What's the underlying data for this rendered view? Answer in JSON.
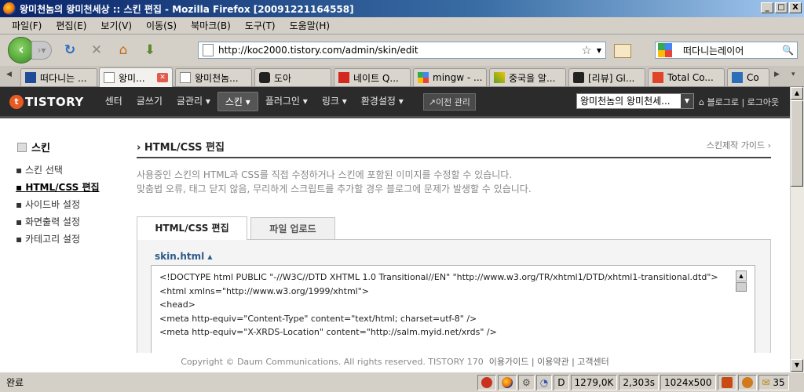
{
  "window": {
    "title": "왕미천놈의 왕미천세상 :: 스킨 편집 - Mozilla Firefox [20091221164558]",
    "controls": [
      "_",
      "□",
      "X"
    ]
  },
  "menu": [
    "파일(F)",
    "편집(E)",
    "보기(V)",
    "이동(S)",
    "북마크(B)",
    "도구(T)",
    "도움말(H)"
  ],
  "nav": {
    "url": "http://koc2000.tistory.com/admin/skin/edit",
    "search_value": "떠다니는레이어"
  },
  "tabs": [
    {
      "label": "떠다니는 ...",
      "active": false
    },
    {
      "label": "왕미...",
      "active": true
    },
    {
      "label": "왕미천놈...",
      "active": false
    },
    {
      "label": "도아",
      "active": false
    },
    {
      "label": "네이트 Q...",
      "active": false
    },
    {
      "label": "mingw - ...",
      "active": false
    },
    {
      "label": "중국을 알...",
      "active": false
    },
    {
      "label": "[리뷰] Gl...",
      "active": false
    },
    {
      "label": "Total Co...",
      "active": false
    },
    {
      "label": "Co",
      "active": false
    }
  ],
  "site": {
    "logo": "TISTORY",
    "logo_mark": "t",
    "gnb": [
      "센터",
      "글쓰기",
      "글관리 ▾",
      "스킨 ▾",
      "플러그인 ▾",
      "링크 ▾",
      "환경설정 ▾"
    ],
    "old_admin": "↗이전 관리",
    "blog_select": "왕미천놈의 왕미천세...",
    "top_links": "⌂ 블로그로  |  로그아웃"
  },
  "lnb": {
    "title": "스킨",
    "items": [
      "스킨 선택",
      "HTML/CSS 편집",
      "사이드바 설정",
      "화면출력 설정",
      "카테고리 설정"
    ]
  },
  "content": {
    "title": "HTML/CSS 편집",
    "guide": "스킨제작 가이드 ›",
    "desc1": "사용중인 스킨의 HTML과 CSS를 직접 수정하거나 스킨에 포함된 이미지를 수정할 수 있습니다.",
    "desc2": "맞춤법 오류, 태그 닫지 않음, 무리하게 스크립트를 추가할 경우 블로그에 문제가 발생할 수 있습니다.",
    "tab_edit": "HTML/CSS 편집",
    "tab_upload": "파일 업로드",
    "file": "skin.html ▴",
    "code": [
      "<!DOCTYPE html PUBLIC \"-//W3C//DTD XHTML 1.0 Transitional//EN\" \"http://www.w3.org/TR/xhtml1/DTD/xhtml1-transitional.dtd\">",
      "<html xmlns=\"http://www.w3.org/1999/xhtml\">",
      "<head>",
      "<meta http-equiv=\"Content-Type\" content=\"text/html; charset=utf-8\" />",
      "<meta http-equiv=\"X-XRDS-Location\" content=\"http://salm.myid.net/xrds\" />"
    ]
  },
  "footer": {
    "copyright": "Copyright © Daum Communications. All rights reserved. TISTORY 170",
    "links": "이용가이드  |  이용약관  |  고객센터"
  },
  "status": {
    "text": "완료",
    "drive": "D",
    "mem": "1279,0K",
    "time": "2,303s",
    "resolution": "1024x500",
    "mail_count": "35"
  }
}
